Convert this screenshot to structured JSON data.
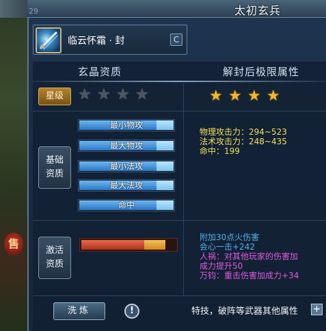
{
  "window": {
    "title": "太初玄兵",
    "page_number": "29"
  },
  "item": {
    "name": "临云怀霜 · 封",
    "icon": "weapon-icon",
    "refresh_icon": "refresh-icon",
    "refresh_glyph": "C"
  },
  "columns": {
    "left_header": "玄晶资质",
    "right_header": "解封后极限属性"
  },
  "star_level": {
    "label": "星级",
    "current_stars": 0,
    "max_stars": 4,
    "unsealed_stars": 4,
    "star_glyph": "★"
  },
  "basic": {
    "label_line1": "基础",
    "label_line2": "资质",
    "bars": [
      {
        "label": "最小物攻",
        "fill_fraction": 0.82
      },
      {
        "label": "最大物攻",
        "fill_fraction": 0.82
      },
      {
        "label": "最小法攻",
        "fill_fraction": 0.82
      },
      {
        "label": "最大法攻",
        "fill_fraction": 0.82
      },
      {
        "label": "命中",
        "fill_fraction": 0.82
      }
    ],
    "stats": [
      "物理攻击力：294~523",
      "法术攻击力：248~435",
      "命中：199"
    ]
  },
  "activation": {
    "label_line1": "激活",
    "label_line2": "资质",
    "fill_fraction": 0.66,
    "tail_fraction": 0.22,
    "effects": [
      {
        "text": "附加30点火伤害",
        "color": "#4fb0f0"
      },
      {
        "text": "会心一击+242",
        "color": "#4fb0f0"
      },
      {
        "text": "人祸：对其他玩家的伤害加",
        "color": "#e05adf"
      },
      {
        "text": "成力提升50",
        "color": "#e05adf"
      },
      {
        "text": "万钧：重击伤害加成力+34",
        "color": "#e05adf"
      }
    ]
  },
  "footer": {
    "wash_button": "洗炼",
    "info_glyph": "!",
    "info_icon": "info-icon",
    "extra_text": "特技，破阵等武器其他属性",
    "plus_glyph": "+",
    "side_orb_glyph": "售"
  },
  "colors": {
    "accent_gold": "#f0b830",
    "stat_yellow": "#f2e05a",
    "effect_blue": "#4fb0f0",
    "effect_pink": "#e05adf"
  }
}
